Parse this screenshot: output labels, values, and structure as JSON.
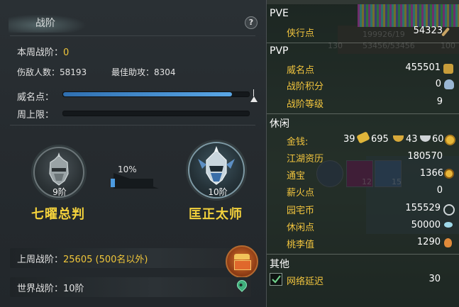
{
  "left": {
    "title": "战阶",
    "help": "?",
    "weekly_rank_label": "本周战阶：",
    "weekly_rank_value": "0",
    "kills_label": "伤敌人数：",
    "kills_value": "58193",
    "best_assist_label": "最佳助攻：",
    "best_assist_value": "8304",
    "prestige_label": "威名点：",
    "prestige_progress": 0.91,
    "weekly_cap_label": "周上限：",
    "weekly_cap_progress": 0,
    "current_rank": {
      "level": "9阶",
      "name": "七曜总判"
    },
    "next_rank": {
      "level": "10阶",
      "name": "匡正太师"
    },
    "advance_percent": "10%",
    "advance_progress": 0.1,
    "last_week_label": "上周战阶：",
    "last_week_value": "25605 (500名以外)",
    "world_rank_label": "世界战阶：",
    "world_rank_value": "10阶"
  },
  "right": {
    "pve": {
      "header": "PVE",
      "items": [
        {
          "label": "侠行点",
          "value": "54323"
        }
      ]
    },
    "pvp": {
      "header": "PVP",
      "items": [
        {
          "label": "威名点",
          "value": "455501"
        },
        {
          "label": "战阶积分",
          "value": "0"
        },
        {
          "label": "战阶等级",
          "value": "9"
        }
      ]
    },
    "leisure": {
      "header": "休闲",
      "money_label": "金钱:",
      "money_gold": "39",
      "money_silver": "695",
      "money_copper": "43",
      "money_coin": "60",
      "items": [
        {
          "label": "江湖资历",
          "value": "180570"
        },
        {
          "label": "通宝",
          "value": "1366"
        },
        {
          "label": "薪火点",
          "value": "0"
        },
        {
          "label": "园宅币",
          "value": "155529"
        },
        {
          "label": "休闲点",
          "value": "50000"
        },
        {
          "label": "桃李值",
          "value": "1290"
        }
      ]
    },
    "other": {
      "header": "其他",
      "latency_label": "网络延迟",
      "latency_value": "30"
    },
    "background_text": {
      "hp": "199926/19",
      "mp": "53456/53456",
      "mp_pct": "100",
      "level": "130",
      "slot1": "12",
      "slot2": "15"
    }
  },
  "colors": {
    "accent_yellow": "#f0c63a",
    "bar_blue": "#4c9be0"
  }
}
